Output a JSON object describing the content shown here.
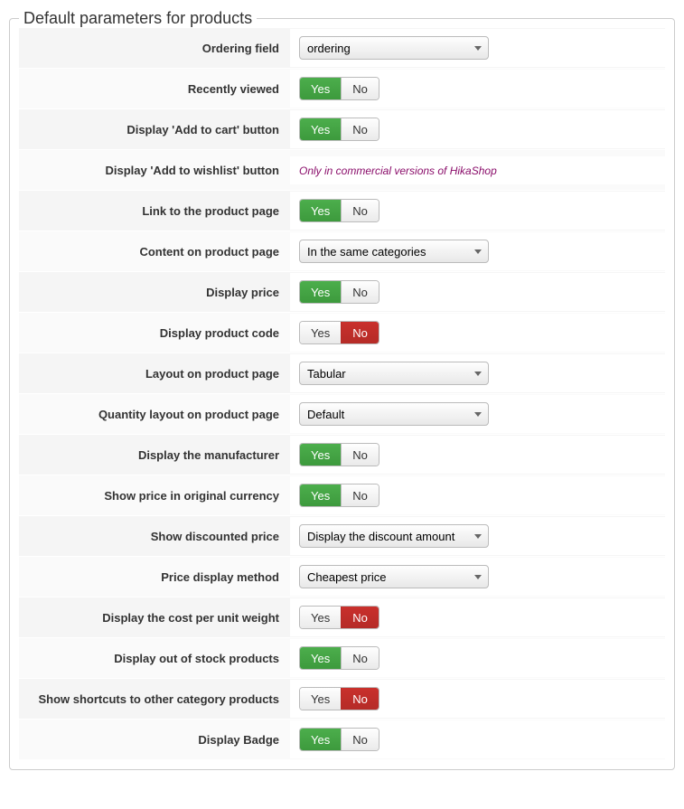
{
  "legend": "Default parameters for products",
  "yes": "Yes",
  "no": "No",
  "rows": {
    "ordering_field": {
      "label": "Ordering field",
      "type": "select",
      "value": "ordering"
    },
    "recently_viewed": {
      "label": "Recently viewed",
      "type": "toggle",
      "value": "yes"
    },
    "add_to_cart": {
      "label": "Display 'Add to cart' button",
      "type": "toggle",
      "value": "yes"
    },
    "add_to_wishlist": {
      "label": "Display 'Add to wishlist' button",
      "type": "note",
      "text": "Only in commercial versions of HikaShop"
    },
    "link_product_page": {
      "label": "Link to the product page",
      "type": "toggle",
      "value": "yes"
    },
    "content_product_page": {
      "label": "Content on product page",
      "type": "select",
      "value": "In the same categories"
    },
    "display_price": {
      "label": "Display price",
      "type": "toggle",
      "value": "yes"
    },
    "display_product_code": {
      "label": "Display product code",
      "type": "toggle",
      "value": "no"
    },
    "layout_product_page": {
      "label": "Layout on product page",
      "type": "select",
      "value": "Tabular"
    },
    "quantity_layout": {
      "label": "Quantity layout on product page",
      "type": "select",
      "value": "Default"
    },
    "display_manufacturer": {
      "label": "Display the manufacturer",
      "type": "toggle",
      "value": "yes"
    },
    "show_price_original": {
      "label": "Show price in original currency",
      "type": "toggle",
      "value": "yes"
    },
    "show_discounted": {
      "label": "Show discounted price",
      "type": "select",
      "value": "Display the discount amount"
    },
    "price_display_method": {
      "label": "Price display method",
      "type": "select",
      "value": "Cheapest price"
    },
    "cost_per_unit_weight": {
      "label": "Display the cost per unit weight",
      "type": "toggle",
      "value": "no"
    },
    "out_of_stock": {
      "label": "Display out of stock products",
      "type": "toggle",
      "value": "yes"
    },
    "shortcuts_category": {
      "label": "Show shortcuts to other category products",
      "type": "toggle",
      "value": "no"
    },
    "display_badge": {
      "label": "Display Badge",
      "type": "toggle",
      "value": "yes"
    }
  },
  "row_order": [
    "ordering_field",
    "recently_viewed",
    "add_to_cart",
    "add_to_wishlist",
    "link_product_page",
    "content_product_page",
    "display_price",
    "display_product_code",
    "layout_product_page",
    "quantity_layout",
    "display_manufacturer",
    "show_price_original",
    "show_discounted",
    "price_display_method",
    "cost_per_unit_weight",
    "out_of_stock",
    "shortcuts_category",
    "display_badge"
  ]
}
